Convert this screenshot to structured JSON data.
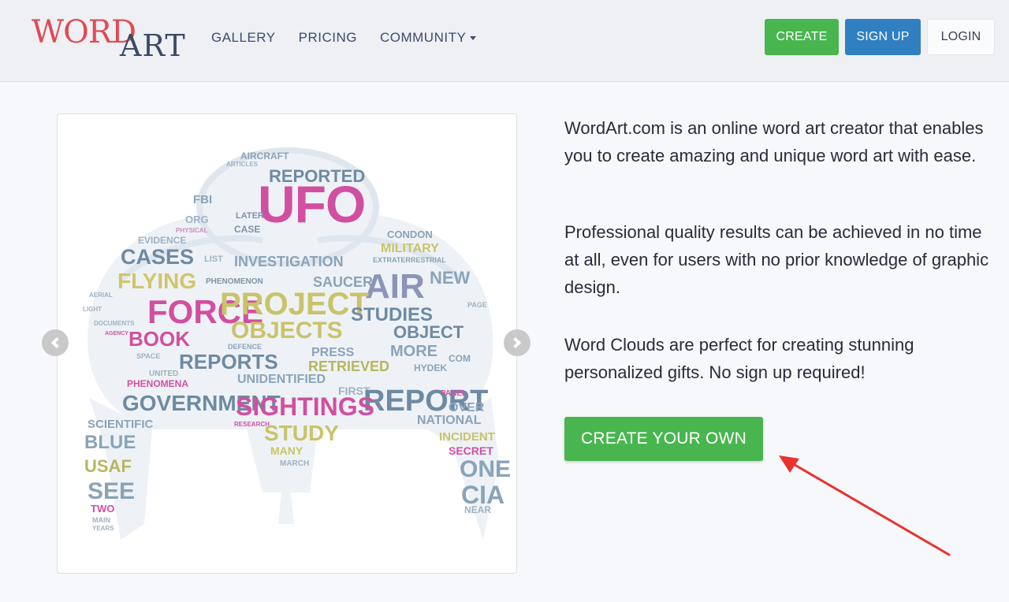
{
  "brand": {
    "logo_word": "WORD",
    "logo_art": "ART",
    "logo_colors": {
      "word": "#e14a55",
      "art": "#3d4a66"
    }
  },
  "nav": {
    "links": [
      {
        "label": "GALLERY"
      },
      {
        "label": "PRICING"
      },
      {
        "label": "COMMUNITY"
      }
    ],
    "buttons": {
      "create": "CREATE",
      "signup": "SIGN UP",
      "login": "LOGIN"
    }
  },
  "carousel": {
    "image": "ufo-word-cloud",
    "words": [
      "UFO",
      "REPORTED",
      "AIRCRAFT",
      "ARTICLES",
      "FBI",
      "ORG",
      "LATER",
      "CASE",
      "PHYSICAL",
      "EVIDENCE",
      "CASES",
      "LIST",
      "INVESTIGATION",
      "CONDON",
      "MILITARY",
      "EXTRATERRESTRIAL",
      "FLYING",
      "PHENOMENON",
      "SAUCER",
      "AIR",
      "NEW",
      "FORCE",
      "PROJECT",
      "STUDIES",
      "OBJECTS",
      "OBJECT",
      "BOOK",
      "DEFENCE",
      "PRESS",
      "MORE",
      "REPORTS",
      "RETRIEVED",
      "HYDEK",
      "COM",
      "UNITED",
      "UNIDENTIFIED",
      "PHENOMENA",
      "FIRST",
      "REPORT",
      "PANEL",
      "OVER",
      "GOVERNMENT",
      "SIGHTINGS",
      "NATIONAL",
      "SCIENTIFIC",
      "RESEARCH",
      "STUDY",
      "INCIDENT",
      "BLUE",
      "MANY",
      "SECRET",
      "USAF",
      "MARCH",
      "ONE",
      "SEE",
      "CIA",
      "NEAR",
      "TWO",
      "MAIN",
      "YEARS",
      "SPACE",
      "AERIAL",
      "DOCUMENTS",
      "AGENCY",
      "LIGHT",
      "PAGE"
    ]
  },
  "intro": {
    "p1": "WordArt.com is an online word art creator that enables you to create amazing and unique word art with ease.",
    "p2": "Professional quality results can be achieved in no time at all, even for users with no prior knowledge of graphic design.",
    "p3": "Word Clouds are perfect for creating stunning personalized gifts. No sign up required!"
  },
  "cta": {
    "label": "CREATE YOUR OWN"
  },
  "colors": {
    "green": "#49b54f",
    "blue": "#2f7fc1",
    "annotation_arrow": "#e8322d"
  }
}
